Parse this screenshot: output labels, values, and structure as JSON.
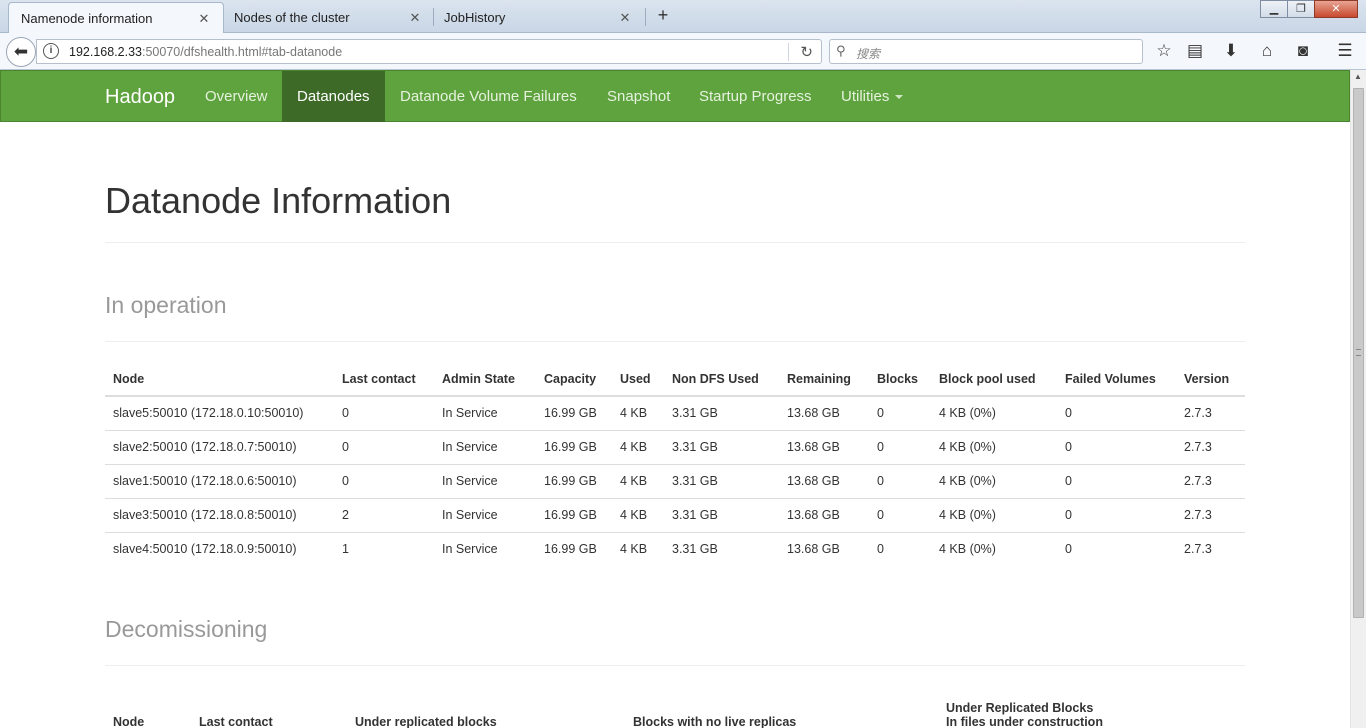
{
  "browser": {
    "tabs": [
      {
        "label": "Namenode information",
        "active": true
      },
      {
        "label": "Nodes of the cluster",
        "active": false
      },
      {
        "label": "JobHistory",
        "active": false
      }
    ],
    "url_host": "192.168.2.33",
    "url_rest": ":50070/dfshealth.html#tab-datanode",
    "search_placeholder": "搜索"
  },
  "nav": {
    "brand": "Hadoop",
    "items": [
      {
        "label": "Overview"
      },
      {
        "label": "Datanodes"
      },
      {
        "label": "Datanode Volume Failures"
      },
      {
        "label": "Snapshot"
      },
      {
        "label": "Startup Progress"
      },
      {
        "label": "Utilities"
      }
    ],
    "active": "Datanodes"
  },
  "page": {
    "title": "Datanode Information",
    "in_operation_heading": "In operation",
    "decommissioning_heading": "Decomissioning"
  },
  "in_operation": {
    "columns": [
      "Node",
      "Last contact",
      "Admin State",
      "Capacity",
      "Used",
      "Non DFS Used",
      "Remaining",
      "Blocks",
      "Block pool used",
      "Failed Volumes",
      "Version"
    ],
    "rows": [
      [
        "slave5:50010 (172.18.0.10:50010)",
        "0",
        "In Service",
        "16.99 GB",
        "4 KB",
        "3.31 GB",
        "13.68 GB",
        "0",
        "4 KB (0%)",
        "0",
        "2.7.3"
      ],
      [
        "slave2:50010 (172.18.0.7:50010)",
        "0",
        "In Service",
        "16.99 GB",
        "4 KB",
        "3.31 GB",
        "13.68 GB",
        "0",
        "4 KB (0%)",
        "0",
        "2.7.3"
      ],
      [
        "slave1:50010 (172.18.0.6:50010)",
        "0",
        "In Service",
        "16.99 GB",
        "4 KB",
        "3.31 GB",
        "13.68 GB",
        "0",
        "4 KB (0%)",
        "0",
        "2.7.3"
      ],
      [
        "slave3:50010 (172.18.0.8:50010)",
        "2",
        "In Service",
        "16.99 GB",
        "4 KB",
        "3.31 GB",
        "13.68 GB",
        "0",
        "4 KB (0%)",
        "0",
        "2.7.3"
      ],
      [
        "slave4:50010 (172.18.0.9:50010)",
        "1",
        "In Service",
        "16.99 GB",
        "4 KB",
        "3.31 GB",
        "13.68 GB",
        "0",
        "4 KB (0%)",
        "0",
        "2.7.3"
      ]
    ]
  },
  "decommissioning": {
    "columns": [
      "Node",
      "Last contact",
      "Under replicated blocks",
      "Blocks with no live replicas"
    ],
    "last_column_line1": "Under Replicated Blocks",
    "last_column_line2": "In files under construction"
  }
}
